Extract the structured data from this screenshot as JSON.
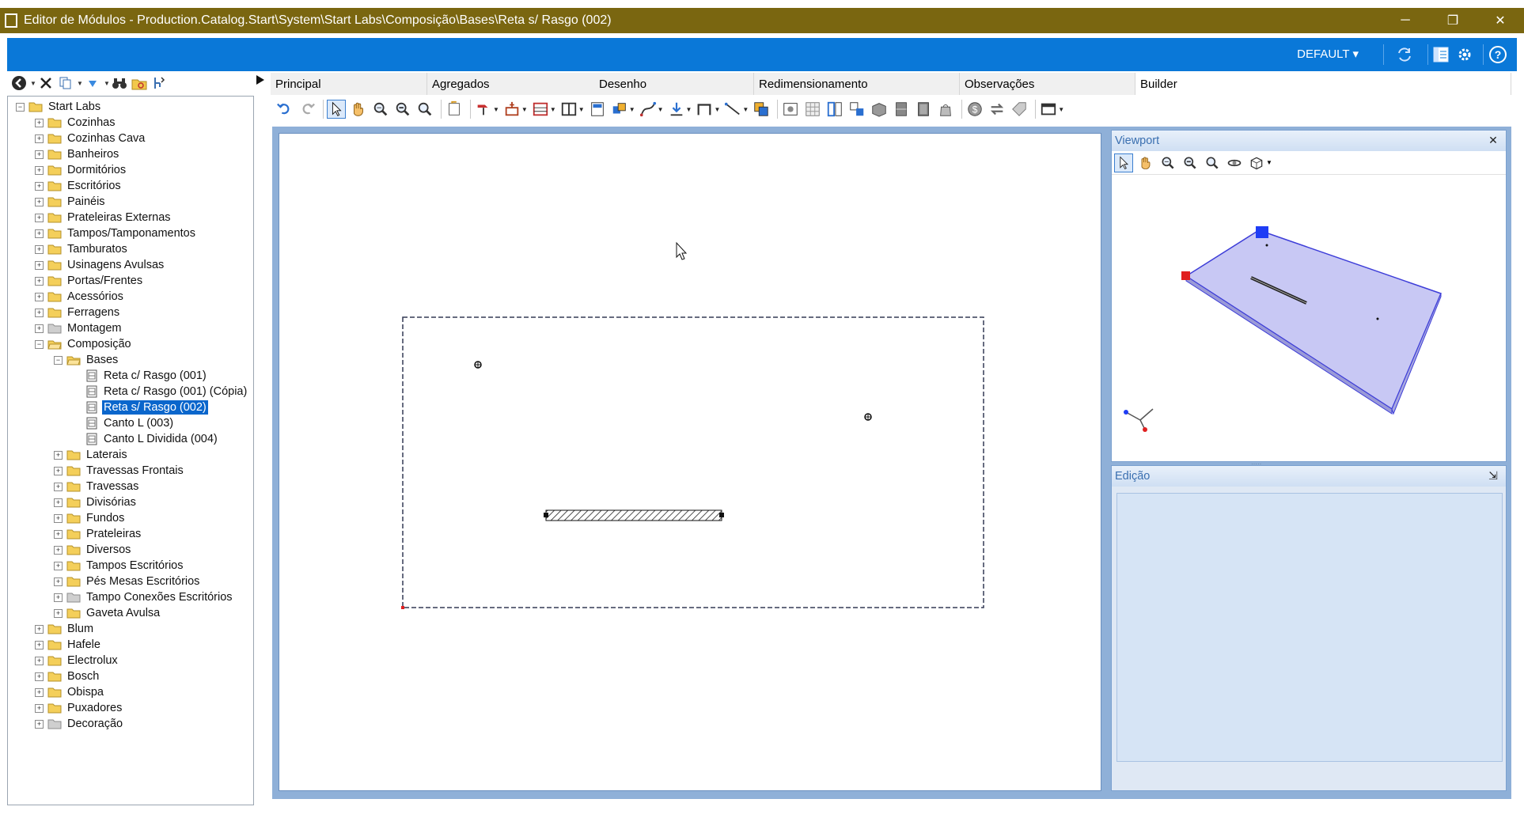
{
  "window": {
    "title": "Editor de Módulos - Production.Catalog.Start\\System\\Start Labs\\Composição\\Bases\\Reta s/ Rasgo (002)",
    "controls": {
      "minimize": "─",
      "maximize": "❐",
      "close": "✕"
    }
  },
  "header": {
    "profile_label": "DEFAULT ▾"
  },
  "tree": {
    "nodes": [
      {
        "label": "Start Labs",
        "level": 0,
        "expander": "−",
        "kind": "folder"
      },
      {
        "label": "Cozinhas",
        "level": 1,
        "expander": "+",
        "kind": "folder"
      },
      {
        "label": "Cozinhas Cava",
        "level": 1,
        "expander": "+",
        "kind": "folder"
      },
      {
        "label": "Banheiros",
        "level": 1,
        "expander": "+",
        "kind": "folder"
      },
      {
        "label": "Dormitórios",
        "level": 1,
        "expander": "+",
        "kind": "folder"
      },
      {
        "label": "Escritórios",
        "level": 1,
        "expander": "+",
        "kind": "folder"
      },
      {
        "label": "Painéis",
        "level": 1,
        "expander": "+",
        "kind": "folder"
      },
      {
        "label": "Prateleiras Externas",
        "level": 1,
        "expander": "+",
        "kind": "folder"
      },
      {
        "label": "Tampos/Tamponamentos",
        "level": 1,
        "expander": "+",
        "kind": "folder"
      },
      {
        "label": "Tamburatos",
        "level": 1,
        "expander": "+",
        "kind": "folder"
      },
      {
        "label": "Usinagens Avulsas",
        "level": 1,
        "expander": "+",
        "kind": "folder"
      },
      {
        "label": "Portas/Frentes",
        "level": 1,
        "expander": "+",
        "kind": "folder"
      },
      {
        "label": "Acessórios",
        "level": 1,
        "expander": "+",
        "kind": "folder"
      },
      {
        "label": "Ferragens",
        "level": 1,
        "expander": "+",
        "kind": "folder"
      },
      {
        "label": "Montagem",
        "level": 1,
        "expander": "+",
        "kind": "folder-gray"
      },
      {
        "label": "Composição",
        "level": 1,
        "expander": "−",
        "kind": "folder-open"
      },
      {
        "label": "Bases",
        "level": 2,
        "expander": "−",
        "kind": "folder-open"
      },
      {
        "label": "Reta c/ Rasgo (001)",
        "level": 3,
        "expander": "",
        "kind": "doc"
      },
      {
        "label": "Reta c/ Rasgo (001) (Cópia)",
        "level": 3,
        "expander": "",
        "kind": "doc"
      },
      {
        "label": "Reta s/ Rasgo (002)",
        "level": 3,
        "expander": "",
        "kind": "doc",
        "selected": true
      },
      {
        "label": "Canto L (003)",
        "level": 3,
        "expander": "",
        "kind": "doc"
      },
      {
        "label": "Canto L Dividida (004)",
        "level": 3,
        "expander": "",
        "kind": "doc"
      },
      {
        "label": "Laterais",
        "level": 2,
        "expander": "+",
        "kind": "folder"
      },
      {
        "label": "Travessas Frontais",
        "level": 2,
        "expander": "+",
        "kind": "folder"
      },
      {
        "label": "Travessas",
        "level": 2,
        "expander": "+",
        "kind": "folder"
      },
      {
        "label": "Divisórias",
        "level": 2,
        "expander": "+",
        "kind": "folder"
      },
      {
        "label": "Fundos",
        "level": 2,
        "expander": "+",
        "kind": "folder"
      },
      {
        "label": "Prateleiras",
        "level": 2,
        "expander": "+",
        "kind": "folder"
      },
      {
        "label": "Diversos",
        "level": 2,
        "expander": "+",
        "kind": "folder"
      },
      {
        "label": "Tampos Escritórios",
        "level": 2,
        "expander": "+",
        "kind": "folder"
      },
      {
        "label": "Pés Mesas Escritórios",
        "level": 2,
        "expander": "+",
        "kind": "folder"
      },
      {
        "label": "Tampo Conexões Escritórios",
        "level": 2,
        "expander": "+",
        "kind": "folder-gray"
      },
      {
        "label": "Gaveta Avulsa",
        "level": 2,
        "expander": "+",
        "kind": "folder"
      },
      {
        "label": "Blum",
        "level": 1,
        "expander": "+",
        "kind": "folder"
      },
      {
        "label": "Hafele",
        "level": 1,
        "expander": "+",
        "kind": "folder"
      },
      {
        "label": "Electrolux",
        "level": 1,
        "expander": "+",
        "kind": "folder"
      },
      {
        "label": "Bosch",
        "level": 1,
        "expander": "+",
        "kind": "folder"
      },
      {
        "label": "Obispa",
        "level": 1,
        "expander": "+",
        "kind": "folder"
      },
      {
        "label": "Puxadores",
        "level": 1,
        "expander": "+",
        "kind": "folder"
      },
      {
        "label": "Decoração",
        "level": 1,
        "expander": "+",
        "kind": "folder-gray"
      }
    ]
  },
  "tabs": [
    {
      "label": "Principal",
      "active": false
    },
    {
      "label": "Agregados",
      "active": false
    },
    {
      "label": "Desenho",
      "active": false
    },
    {
      "label": "Redimensionamento",
      "active": false
    },
    {
      "label": "Observações",
      "active": false
    },
    {
      "label": "Builder",
      "active": true
    }
  ],
  "panels": {
    "viewport_title": "Viewport",
    "viewport_close": "✕",
    "edicao_title": "Edição",
    "edicao_pin": "⇲"
  },
  "colors": {
    "titlebar": "#7a6610",
    "accent": "#0a78d8",
    "selection": "#0a66cc",
    "plate": "#c8c8f4",
    "handle_blue": "#1f3df5",
    "handle_red": "#e02020"
  },
  "icons": {
    "left_toolbar": [
      "back-icon",
      "delete-icon",
      "copy-icon",
      "move-icon",
      "binoculars-icon",
      "refresh-folder-icon",
      "branch-icon"
    ],
    "main_toolbar": [
      "undo-icon",
      "redo-icon",
      "select-icon",
      "pan-icon",
      "zoom-window-icon",
      "zoom-out-icon",
      "zoom-icon",
      "import-icon",
      "paint-icon",
      "insert-icon",
      "split-h-icon",
      "split-v-icon",
      "panel-icon",
      "assembly-icon",
      "spline-icon",
      "drop-icon",
      "bracket-icon",
      "line-icon",
      "copy-layers-icon",
      "render-icon",
      "grid-icon",
      "columns-icon",
      "transfer-icon",
      "box-icon",
      "drawer-icon",
      "door-icon",
      "bag-icon",
      "money-icon",
      "swap-icon",
      "tag-icon",
      "window-icon"
    ],
    "viewport_toolbar": [
      "select-icon",
      "pan-icon",
      "zoom-window-icon",
      "zoom-out-icon",
      "zoom-icon",
      "orbit-icon",
      "cube-view-icon"
    ]
  }
}
